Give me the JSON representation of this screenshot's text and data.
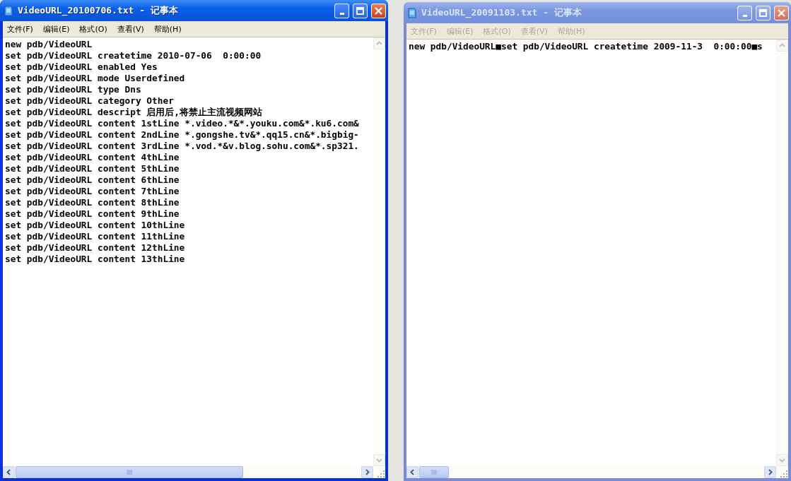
{
  "windows": [
    {
      "title": "VideoURL_20100706.txt - 记事本",
      "active": true,
      "menu": [
        "文件(F)",
        "编辑(E)",
        "格式(O)",
        "查看(V)",
        "帮助(H)"
      ],
      "lines": [
        "new pdb/VideoURL",
        "set pdb/VideoURL createtime 2010-07-06  0:00:00",
        "set pdb/VideoURL enabled Yes",
        "set pdb/VideoURL mode Userdefined",
        "set pdb/VideoURL type Dns",
        "set pdb/VideoURL category Other",
        "set pdb/VideoURL descript 启用后,将禁止主流视频网站",
        "set pdb/VideoURL content 1stLine *.video.*&*.youku.com&*.ku6.com&",
        "set pdb/VideoURL content 2ndLine *.gongshe.tv&*.qq15.cn&*.bigbig-",
        "set pdb/VideoURL content 3rdLine *.vod.*&v.blog.sohu.com&*.sp321.",
        "set pdb/VideoURL content 4thLine",
        "set pdb/VideoURL content 5thLine",
        "set pdb/VideoURL content 6thLine",
        "set pdb/VideoURL content 7thLine",
        "set pdb/VideoURL content 8thLine",
        "set pdb/VideoURL content 9thLine",
        "set pdb/VideoURL content 10thLine",
        "set pdb/VideoURL content 11thLine",
        "set pdb/VideoURL content 12thLine",
        "set pdb/VideoURL content 13thLine"
      ]
    },
    {
      "title": "VideoURL_20091103.txt - 记事本",
      "active": false,
      "menu": [
        "文件(F)",
        "编辑(E)",
        "格式(O)",
        "查看(V)",
        "帮助(H)"
      ],
      "lines": [
        "new pdb/VideoURL■set pdb/VideoURL createtime 2009-11-3  0:00:00■s"
      ]
    }
  ]
}
